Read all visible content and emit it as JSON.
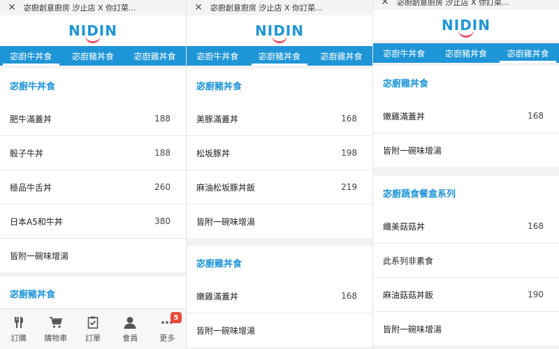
{
  "colors": {
    "accent": "#1e95d6",
    "logo_smile": "#e84a5f",
    "badge": "#e84a3c"
  },
  "screens": [
    {
      "topbar": {
        "close_icon": "✕",
        "title": "宓廚創意廚房 汐止店 X 你訂菜..."
      },
      "logo": "NIDIN",
      "tabs": [
        "宓廚牛丼食",
        "宓廚豬丼食",
        "宓廚雞丼食"
      ],
      "sections": [
        {
          "title": "宓廚牛丼食",
          "items": [
            {
              "name": "肥牛滿蓋丼",
              "price": "188"
            },
            {
              "name": "骰子牛丼",
              "price": "188"
            },
            {
              "name": "極品牛舌丼",
              "price": "260"
            },
            {
              "name": "日本A5和牛丼",
              "price": "380"
            },
            {
              "name": "皆附一碗味增湯",
              "price": ""
            }
          ]
        },
        {
          "title": "宓廚豬丼食",
          "items": []
        }
      ],
      "bottom_nav": [
        {
          "icon": "utensils-icon",
          "label": "訂購"
        },
        {
          "icon": "cart-icon",
          "label": "購物車"
        },
        {
          "icon": "clipboard-icon",
          "label": "訂單"
        },
        {
          "icon": "user-icon",
          "label": "會員"
        },
        {
          "icon": "more-icon",
          "label": "更多",
          "badge": "5"
        }
      ]
    },
    {
      "topbar": {
        "close_icon": "✕",
        "title": "宓廚創意廚房 汐止店 X 你訂菜..."
      },
      "logo": "NIDIN",
      "tabs": [
        "宓廚牛丼食",
        "宓廚豬丼食",
        "宓廚雞丼食"
      ],
      "sections": [
        {
          "title": "宓廚豬丼食",
          "items": [
            {
              "name": "美豚滿蓋丼",
              "price": "168"
            },
            {
              "name": "松坂豚丼",
              "price": "198"
            },
            {
              "name": "麻油松坂豚丼飯",
              "price": "219"
            },
            {
              "name": "皆附一碗味增湯",
              "price": ""
            }
          ]
        },
        {
          "title": "宓廚雞丼食",
          "items": [
            {
              "name": "嫩雞滿蓋丼",
              "price": "168"
            },
            {
              "name": "皆附一碗味增湯",
              "price": ""
            }
          ]
        }
      ]
    },
    {
      "topbar": {
        "close_icon": "✕",
        "title": "宓廚創意廚房 汐止店 X 你訂菜..."
      },
      "logo": "NIDIN",
      "tabs": [
        "宓廚牛丼食",
        "宓廚豬丼食",
        "宓廚雞丼食"
      ],
      "sections": [
        {
          "title": "宓廚雞丼食",
          "items": [
            {
              "name": "嫩雞滿蓋丼",
              "price": "168"
            },
            {
              "name": "皆附一碗味增湯",
              "price": ""
            }
          ]
        },
        {
          "title": "宓廚蔬食餐盒系列",
          "items": [
            {
              "name": "纖美菇菇丼",
              "price": "168"
            },
            {
              "name": "此系列非素食",
              "price": ""
            },
            {
              "name": "麻油菇菇丼飯",
              "price": "190"
            },
            {
              "name": "皆附一碗味增湯",
              "price": ""
            }
          ]
        }
      ]
    }
  ]
}
